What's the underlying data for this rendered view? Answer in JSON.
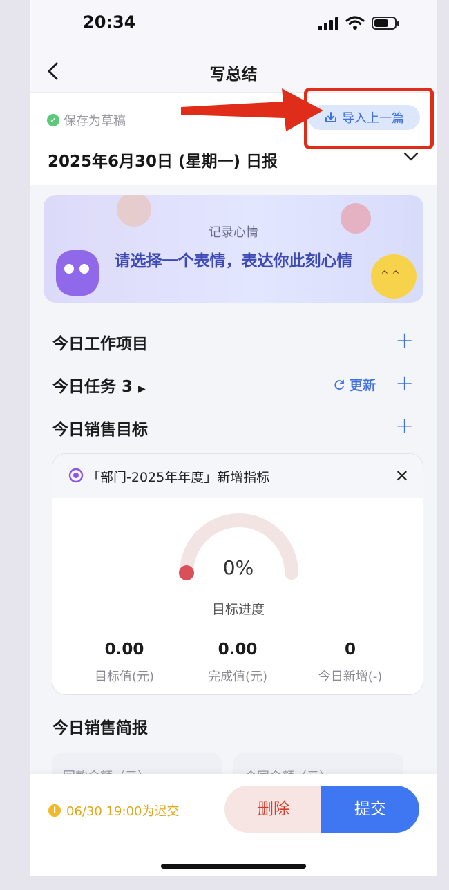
{
  "status": {
    "time": "20:34"
  },
  "nav": {
    "title": "写总结"
  },
  "header": {
    "draft_label": "保存为草稿",
    "import_label": "导入上一篇",
    "date_title": "2025年6月30日 (星期一) 日报"
  },
  "mood": {
    "subtitle": "记录心情",
    "prompt": "请选择一个表情，表达你此刻心情"
  },
  "sections": {
    "work_items": "今日工作项目",
    "tasks": "今日任务 3",
    "refresh": "更新",
    "sales_target": "今日销售目标",
    "sales_brief": "今日销售简报"
  },
  "target_card": {
    "title": "「部门-2025年年度」新增指标",
    "progress_percent": 0,
    "progress_text": "0%",
    "progress_label": "目标进度",
    "stats": [
      {
        "value": "0.00",
        "label": "目标值(元)"
      },
      {
        "value": "0.00",
        "label": "完成值(元)"
      },
      {
        "value": "0",
        "label": "今日新增(-)"
      }
    ]
  },
  "briefs": [
    "回款金额（元）",
    "合同金额（元）"
  ],
  "footer": {
    "deadline": "06/30 19:00为迟交",
    "delete_label": "删除",
    "submit_label": "提交"
  },
  "colors": {
    "accent": "#3f76f2",
    "danger": "#d43c2b",
    "annotation": "#e02d1a"
  }
}
